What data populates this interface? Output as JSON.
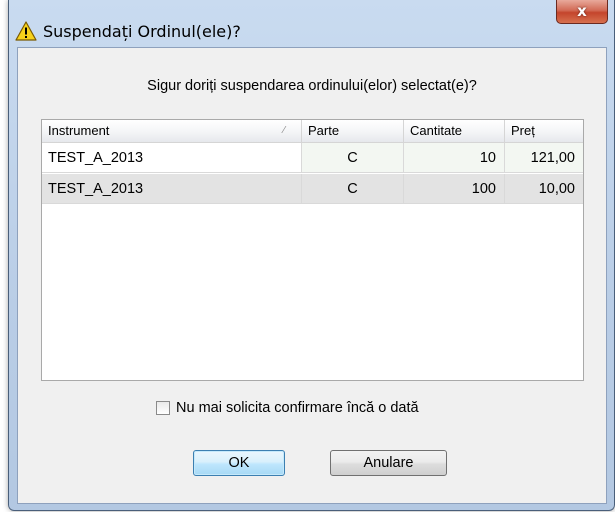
{
  "window": {
    "title": "Suspendați Ordinul(ele)?",
    "close_label": "x",
    "title_icon": "warning-icon"
  },
  "dialog": {
    "question": "Sigur doriți suspendarea ordinului(elor) selectat(e)?",
    "columns": [
      "Instrument",
      "Parte",
      "Cantitate",
      "Preț"
    ],
    "rows": [
      {
        "instrument": "TEST_A_2013",
        "parte": "C",
        "cantitate": "10",
        "pret": "121,00"
      },
      {
        "instrument": "TEST_A_2013",
        "parte": "C",
        "cantitate": "100",
        "pret": "10,00"
      }
    ],
    "checkbox_label": "Nu mai solicita confirmare încă o dată",
    "checkbox_checked": false,
    "ok_label": "OK",
    "cancel_label": "Anulare"
  },
  "colors": {
    "title_bar": "#b9cde6",
    "close_button": "#c4452c",
    "ok_button_border": "#3c7fb1"
  }
}
